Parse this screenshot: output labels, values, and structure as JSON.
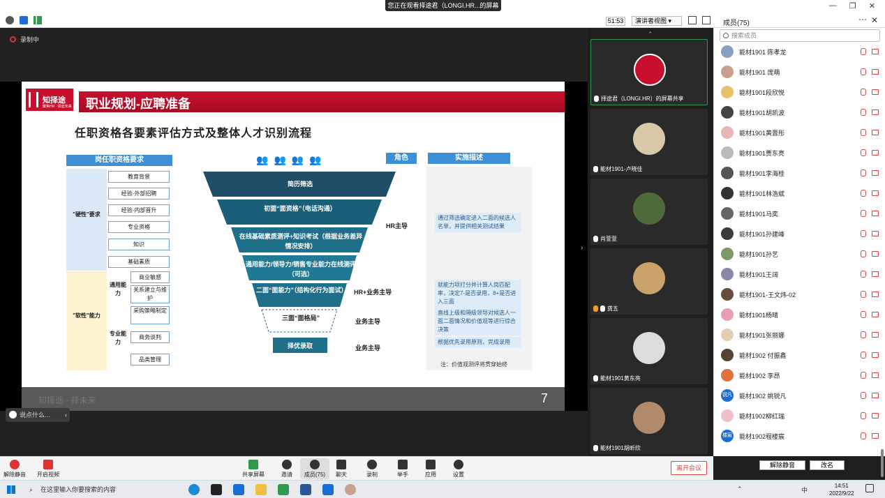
{
  "share_banner": "您正在观看择途君（LONGI.HR...的屏幕",
  "timer": "51:53",
  "view_label": "演讲者视图",
  "panel": {
    "title": "成员(75)",
    "search_placeholder": "搜索成员",
    "mute_all": "解除静音",
    "rename": "改名"
  },
  "recording": "录制中",
  "chat_hint": "说点什么...",
  "slide": {
    "logo": "知择途",
    "logo_sub": "聚焦HR · 择途未来",
    "title": "职业规划-应聘准备",
    "subtitle": "任职资格各要素评估方式及整体人才识别流程",
    "col_requirements": "岗任职资格要求",
    "col_role": "角色",
    "col_desc": "实施描述",
    "hard_group": "\"硬性\"要求",
    "soft_group": "\"软性\"能力",
    "general_ability": "通用能力",
    "pro_ability": "专业能力",
    "requirements": [
      "教育背景",
      "经验-外部招聘",
      "经验-内部晋升",
      "专业资格",
      "知识",
      "基础素质"
    ],
    "soft_items": [
      "商业敏感",
      "关系建立与维护",
      "采购策略制定",
      "商务谈判",
      "品类管理"
    ],
    "funnel": [
      "简历筛选",
      "初面“面资格”（电话沟通）",
      "在线基础素质测评+知识考试（根据业务差异情况安排）",
      "通用能力/领导力/销售专业能力在线测评（可选）",
      "二面“面能力”（结构化行为面试）",
      "三面“面格局”",
      "择优录取"
    ],
    "roles": [
      "HR主导",
      "HR+业务主导",
      "业务主导",
      "业务主导"
    ],
    "descs": [
      "通过筛选确定进入二面的候选人名单，并提供相关测试结果",
      "就能力项打分并计算人岗匹配率，决定7-是否录用，8+是否进入三面",
      "直线上级和隔级领导对候选人一面二面情况和价值观等进行综合决策",
      "根据优先录用原则，完成录用"
    ],
    "note": "注：价值观测评将贯穿始终",
    "footer": "知择途 · 择未来",
    "page": "7"
  },
  "tiles": [
    {
      "name": "择途君（LONGI.HR）的屏幕共享",
      "color": "#c8102e"
    },
    {
      "name": "能材1901-卢晓佳",
      "color": "#d8c9a8"
    },
    {
      "name": "肖萱萱",
      "color": "#4d6b3a"
    },
    {
      "name": "龚五",
      "color": "#c9a36a"
    },
    {
      "name": "能材1901黄东亮",
      "color": "#dcdcdc"
    },
    {
      "name": "能材1901胡昕欣",
      "color": "#b08a6a"
    }
  ],
  "participants": [
    {
      "name": "能材1901 陈孝龙",
      "color": "#8aa0c2"
    },
    {
      "name": "能材1901 庞萌",
      "color": "#c9a090"
    },
    {
      "name": "能材1901段欣悦",
      "color": "#e8c26a"
    },
    {
      "name": "能材1901胡凯波",
      "color": "#444444"
    },
    {
      "name": "能材1901黄晋彤",
      "color": "#e8b5b5"
    },
    {
      "name": "能材1901贾东亮",
      "color": "#bbbbbb"
    },
    {
      "name": "能材1901李海桂",
      "color": "#555555"
    },
    {
      "name": "能材1901林浩斌",
      "color": "#333333"
    },
    {
      "name": "能材1901马奕",
      "color": "#666666"
    },
    {
      "name": "能材1901孙建峰",
      "color": "#3b3b3b"
    },
    {
      "name": "能材1901孙艺",
      "color": "#7a9a6a"
    },
    {
      "name": "能材1901王阔",
      "color": "#8888aa"
    },
    {
      "name": "能材1901-王文炜-02",
      "color": "#6a4a3a"
    },
    {
      "name": "能材1901杨晴",
      "color": "#e8a0b0"
    },
    {
      "name": "能材1901张丽娜",
      "color": "#e0d0b0"
    },
    {
      "name": "能材1902 付振鑫",
      "color": "#554433"
    },
    {
      "name": "能材1902 李昂",
      "color": "#e07040"
    },
    {
      "name": "能材1902 姚锐凡",
      "color": "#1a6ed8",
      "text": "锐凡"
    },
    {
      "name": "能材1902柳红瑞",
      "color": "#f0c0c8"
    },
    {
      "name": "能材1902程楼宸",
      "color": "#1a6ed8",
      "text": "楼宸"
    }
  ],
  "toolbar": {
    "mute": "解除静音",
    "video": "开启视频",
    "share": "共享屏幕",
    "invite": "邀请",
    "members": "成员(75)",
    "chat": "聊天",
    "record": "录制",
    "raise": "举手",
    "apps": "应用",
    "settings": "设置",
    "leave": "离开会议"
  },
  "taskbar": {
    "search": "在这里输入你要搜索的内容",
    "time": "14:51",
    "date": "2022/9/22",
    "ime": "中"
  }
}
